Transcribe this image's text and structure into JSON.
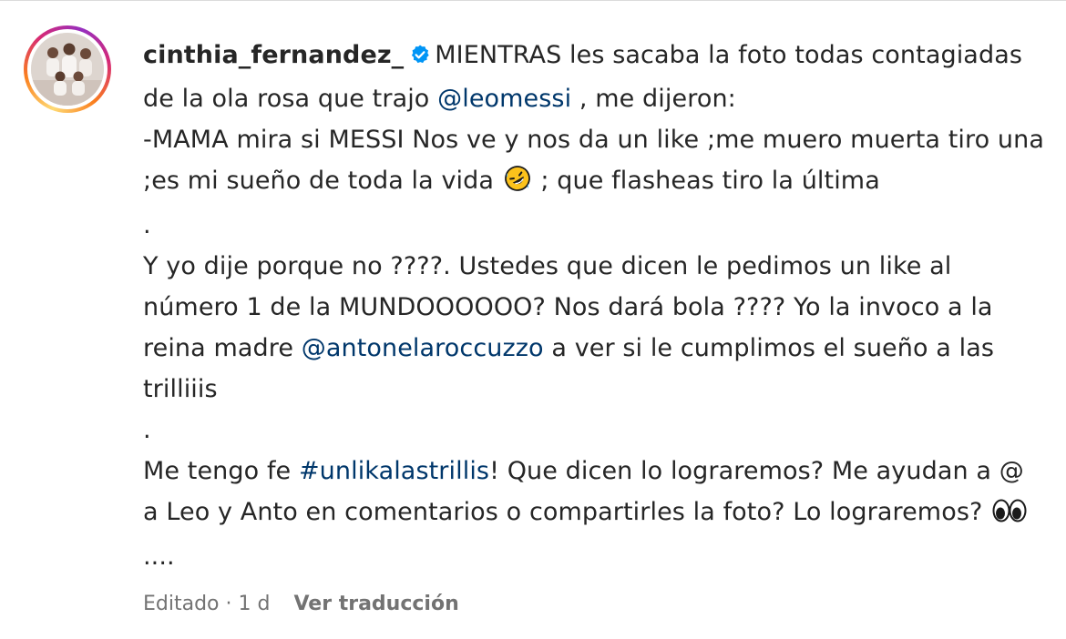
{
  "post": {
    "username": "cinthia_fernandez_",
    "verified": true,
    "caption": {
      "p1_before_mention": "MIENTRAS les sacaba la foto todas contagiadas de la ola rosa que trajo ",
      "mention_1": "@leomessi",
      "p1_after_mention": " , me dijeron:",
      "p1_line2_before_emoji": "-MAMA mira si MESSI Nos ve y nos da un like ;me muero muerta tiro una ;es mi sueño de toda la vida ",
      "emoji_laugh": "rolling-on-floor-laughing-icon",
      "p1_line2_after_emoji": " ; que flasheas tiro la última",
      "dot_1": ".",
      "p2_before_mention": "Y yo dije porque no ????. Ustedes que dicen le pedimos un like al número 1 de la MUNDOOOOOO? Nos dará bola ???? Yo la invoco a la reina madre ",
      "mention_2": "@antonelaroccuzzo",
      "p2_after_mention": " a ver si le cumplimos el sueño a las trilliiis",
      "dot_2": ".",
      "p3_before_hashtag": "Me tengo fe ",
      "hashtag": "#unlikalastrillis",
      "p3_after_hashtag": "! Que dicen lo lograremos? Me ayudan a @ a Leo y Anto en comentarios o compartirles la foto? Lo lograremos? ",
      "emoji_eyes": "eyes-icon",
      "p3_end": "...."
    },
    "edited_label": "Editado",
    "separator": " · ",
    "time_ago": "1 d",
    "translate_label": "Ver traducción"
  },
  "colors": {
    "text": "#262626",
    "link": "#00376b",
    "meta": "#737373",
    "verified": "#0095f6"
  }
}
